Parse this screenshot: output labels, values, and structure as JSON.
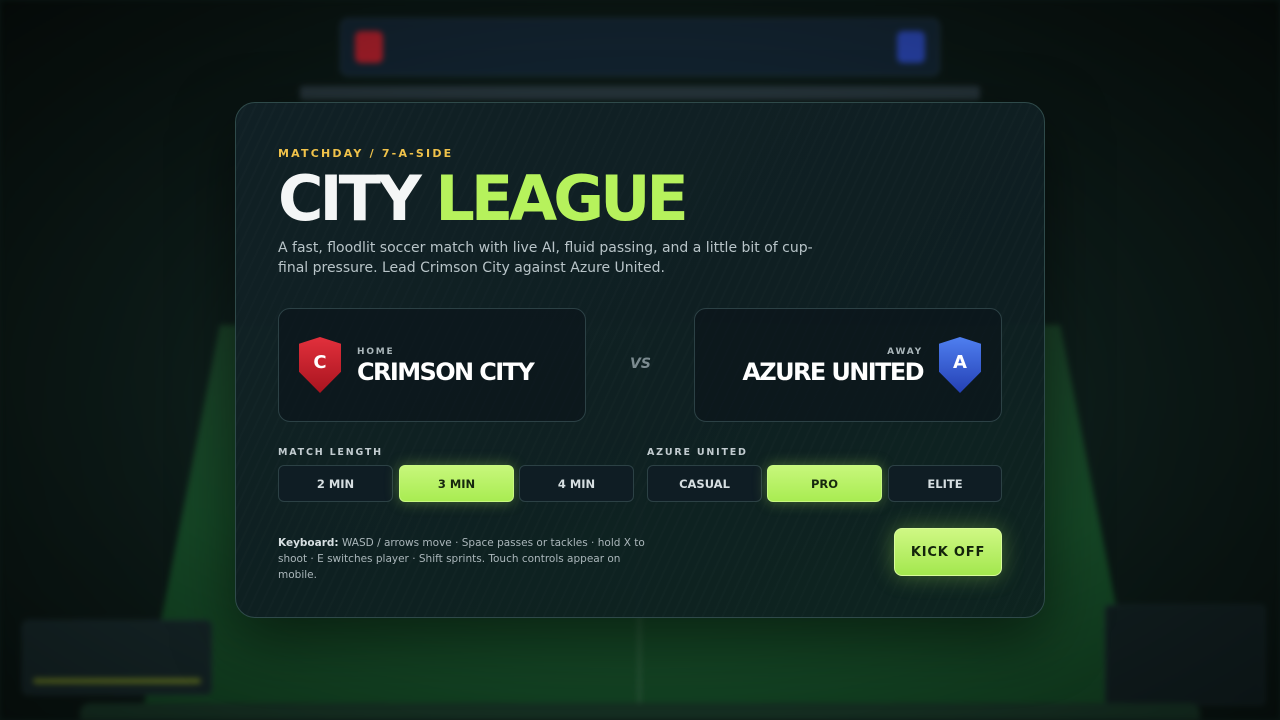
{
  "modal": {
    "eyebrow": "MATCHDAY / 7-A-SIDE",
    "title_part1": "CITY",
    "title_part2": "LEAGUE",
    "description": "A fast, floodlit soccer match with live AI, fluid passing, and a little bit of cup-final pressure. Lead Crimson City against Azure United.",
    "home": {
      "side_label": "HOME",
      "name": "CRIMSON CITY",
      "badge_letter": "C",
      "badge_color": "#c91f2b"
    },
    "vs_label": "VS",
    "away": {
      "side_label": "AWAY",
      "name": "AZURE UNITED",
      "badge_letter": "A",
      "badge_color": "#3358d0"
    },
    "match_length": {
      "label": "MATCH LENGTH",
      "options": [
        "2 MIN",
        "3 MIN",
        "4 MIN"
      ],
      "selected": "3 MIN"
    },
    "difficulty": {
      "label": "AZURE UNITED",
      "options": [
        "CASUAL",
        "PRO",
        "ELITE"
      ],
      "selected": "PRO"
    },
    "keyboard_label": "Keyboard:",
    "keyboard_text": "WASD / arrows move · Space passes or tackles · hold X to shoot · E switches player · Shift sprints. Touch controls appear on mobile.",
    "kickoff_label": "KICK OFF"
  },
  "colors": {
    "accent": "#b6f25c",
    "eyebrow": "#f0c24a",
    "card_bg": "#10232a"
  }
}
